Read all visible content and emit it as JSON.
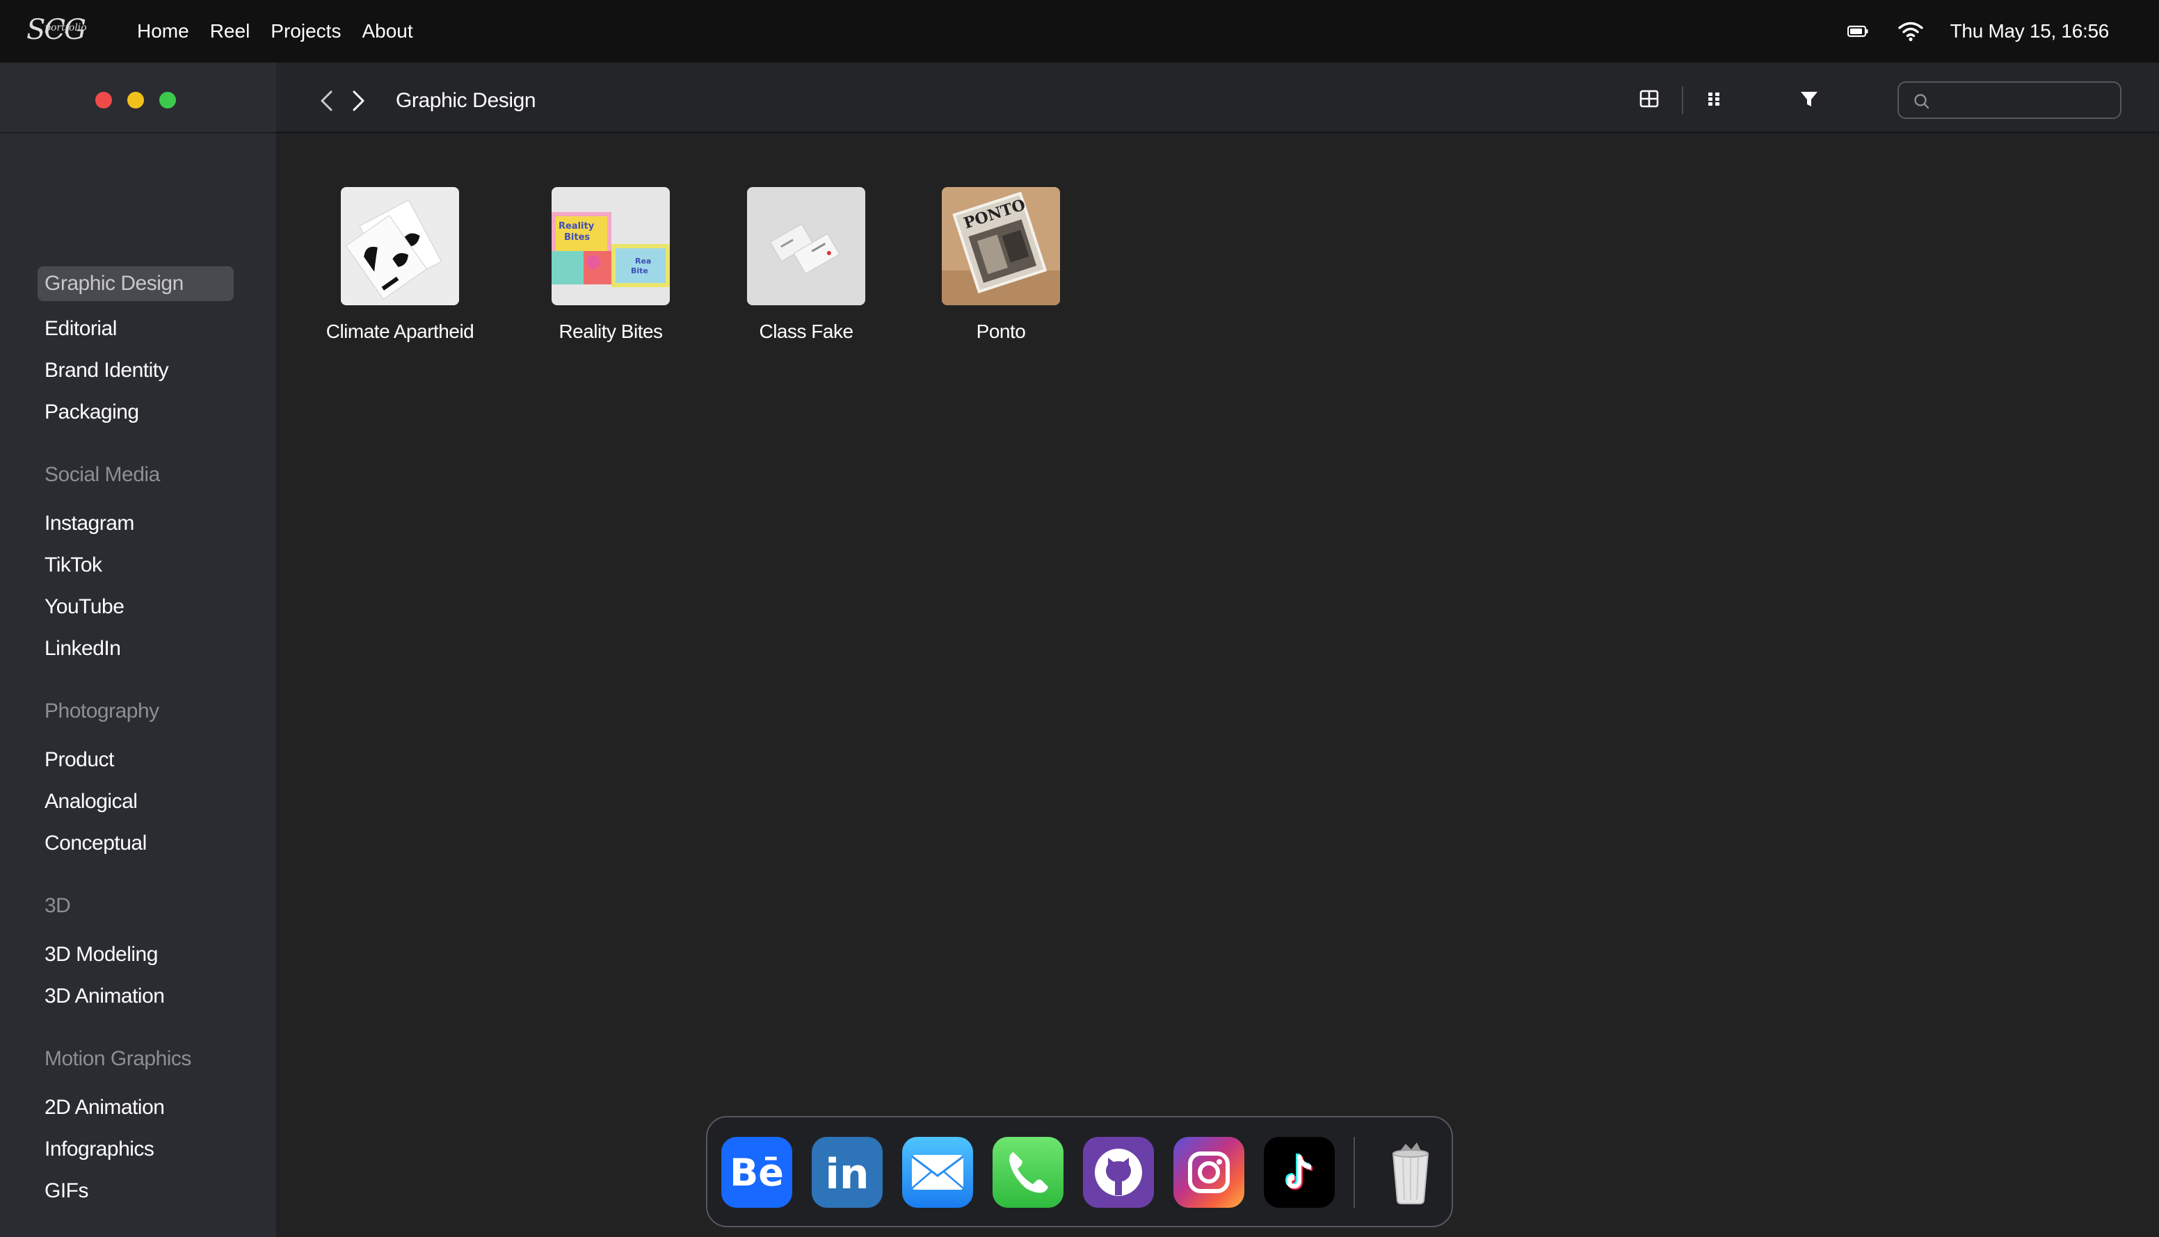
{
  "menubar": {
    "logo_text": "SCG",
    "logo_sub": "portfolio",
    "links": [
      "Home",
      "Reel",
      "Projects",
      "About"
    ],
    "status_icons": [
      "battery-icon",
      "wifi-icon"
    ],
    "clock": "Thu May 15, 16:56"
  },
  "window": {
    "traffic_lights": {
      "close": "#ef4b4b",
      "minimize": "#f1c21b",
      "zoom": "#3dc94b"
    }
  },
  "sidebar": {
    "groups": [
      {
        "heading": "Graphic Design",
        "active": true,
        "items": [
          "Editorial",
          "Brand Identity",
          "Packaging"
        ]
      },
      {
        "heading": "Social Media",
        "items": [
          "Instagram",
          "TikTok",
          "YouTube",
          "LinkedIn"
        ]
      },
      {
        "heading": "Photography",
        "items": [
          "Product",
          "Analogical",
          "Conceptual"
        ]
      },
      {
        "heading": "3D",
        "items": [
          "3D Modeling",
          "3D Animation"
        ]
      },
      {
        "heading": "Motion Graphics",
        "items": [
          "2D Animation",
          "Infographics",
          "GIFs"
        ]
      }
    ]
  },
  "toolbar": {
    "back_icon": "chevron-left-icon",
    "forward_icon": "chevron-right-icon",
    "title": "Graphic Design",
    "view_icons": [
      "grid-view-icon",
      "apps-view-icon",
      "filter-icon"
    ],
    "search_placeholder": ""
  },
  "files": [
    {
      "name": "Climate Apartheid"
    },
    {
      "name": "Reality Bites"
    },
    {
      "name": "Class Fake"
    },
    {
      "name": "Ponto"
    }
  ],
  "dock": {
    "apps": [
      "behance-icon",
      "linkedin-icon",
      "mail-icon",
      "phone-icon",
      "github-icon",
      "instagram-icon",
      "tiktok-icon",
      "trash-icon"
    ]
  },
  "colors": {
    "accent_blue": "#1769ff",
    "linkedin": "#2d74b8",
    "phone_green": "#3ecb4c",
    "github_purple": "#6b3fa8",
    "tiktok_black": "#000000"
  }
}
